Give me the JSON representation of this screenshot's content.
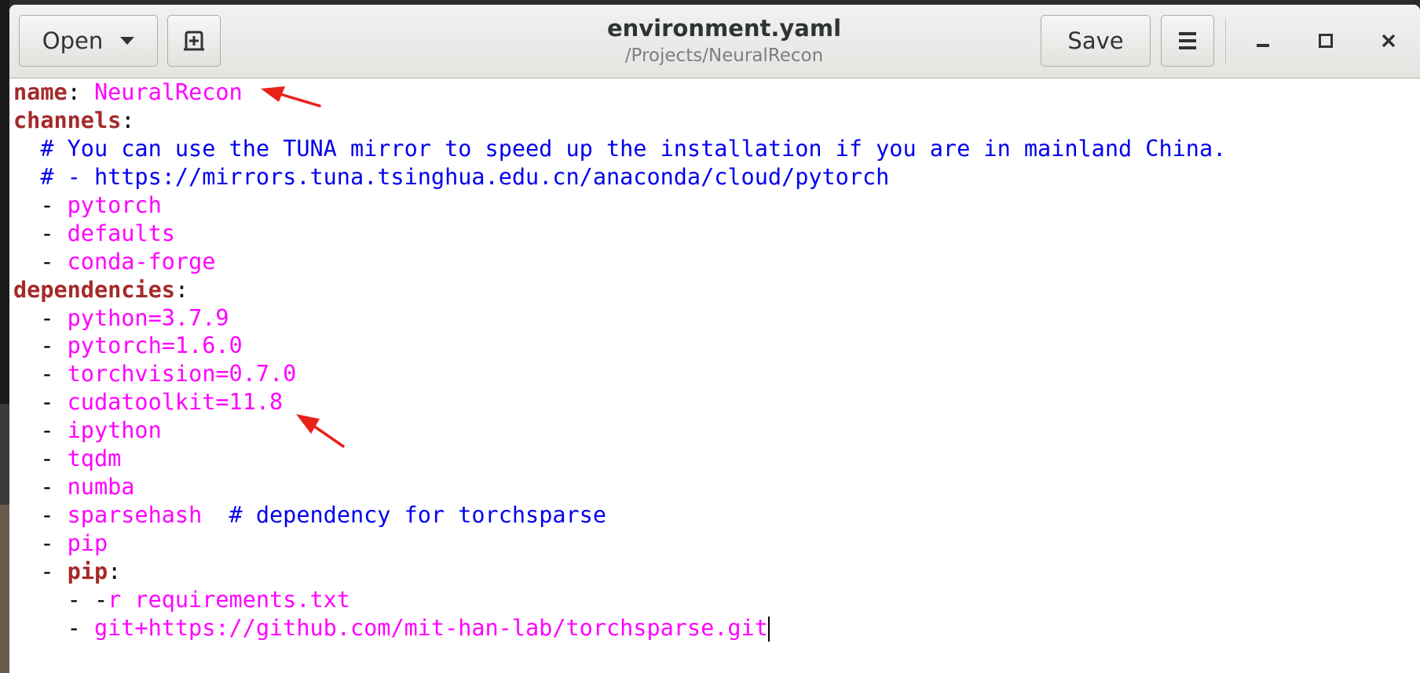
{
  "window": {
    "title": "environment.yaml",
    "subtitle": "/Projects/NeuralRecon",
    "open_label": "Open",
    "save_label": "Save"
  },
  "icons": {
    "open_dropdown": "chevron-down-icon",
    "new_document": "new-document-icon",
    "menu": "hamburger-menu-icon",
    "minimize": "minimize-icon",
    "maximize": "maximize-icon",
    "close": "close-icon"
  },
  "colors": {
    "yaml_key": "#a52a2a",
    "yaml_string": "#ff00ff",
    "yaml_comment": "#0000ee",
    "annotation_arrow": "#e8221b"
  },
  "editor": {
    "lines": [
      {
        "key": "name",
        "sep": ": ",
        "value": "NeuralRecon"
      },
      {
        "key": "channels",
        "sep": ":"
      },
      {
        "comment": "  # You can use the TUNA mirror to speed up the installation if you are in mainland China."
      },
      {
        "comment": "  # - https://mirrors.tuna.tsinghua.edu.cn/anaconda/cloud/pytorch"
      },
      {
        "dash": "  - ",
        "value": "pytorch"
      },
      {
        "dash": "  - ",
        "value": "defaults"
      },
      {
        "dash": "  - ",
        "value": "conda-forge"
      },
      {
        "key": "dependencies",
        "sep": ":"
      },
      {
        "dash": "  - ",
        "value": "python=3.7.9"
      },
      {
        "dash": "  - ",
        "value": "pytorch=1.6.0"
      },
      {
        "dash": "  - ",
        "value": "torchvision=0.7.0"
      },
      {
        "dash": "  - ",
        "value": "cudatoolkit=11.8"
      },
      {
        "dash": "  - ",
        "value": "ipython"
      },
      {
        "dash": "  - ",
        "value": "tqdm"
      },
      {
        "dash": "  - ",
        "value": "numba"
      },
      {
        "dash": "  - ",
        "value": "sparsehash",
        "trailing_comment": "  # dependency for torchsparse"
      },
      {
        "dash": "  - ",
        "value": "pip"
      },
      {
        "dash": "  - ",
        "key": "pip",
        "sep": ":"
      },
      {
        "dash": "    - -",
        "value": "r requirements.txt"
      },
      {
        "dash": "    - ",
        "value": "git+https://github.com/mit-han-lab/torchsparse.git",
        "cursor": true
      }
    ]
  }
}
